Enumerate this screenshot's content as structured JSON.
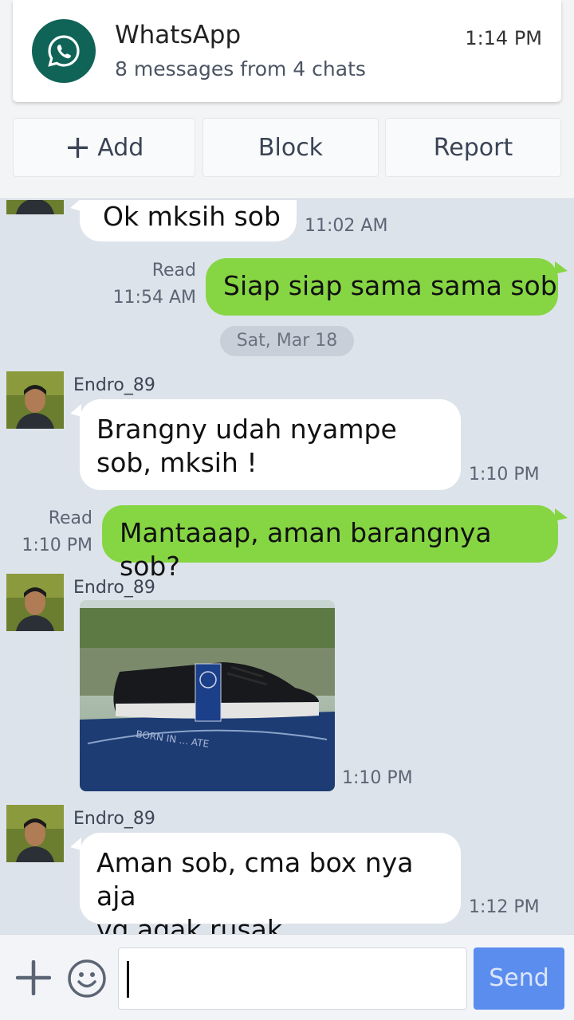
{
  "notification": {
    "app_name": "WhatsApp",
    "summary": "8 messages from 4 chats",
    "time": "1:14 PM",
    "icon": "whatsapp-icon"
  },
  "actions": {
    "add_label": "Add",
    "block_label": "Block",
    "report_label": "Report"
  },
  "chat": {
    "messages": [
      {
        "direction": "in",
        "text": "Ok mksih sob",
        "time": "11:02 AM"
      },
      {
        "direction": "out",
        "read": "Read",
        "text": "Siap siap sama sama sob",
        "time": "11:54 AM"
      },
      {
        "type": "date",
        "text": "Sat, Mar 18"
      },
      {
        "direction": "in",
        "sender": "Endro_89",
        "text_lines": [
          "Brangny udah nyampe",
          "sob, mksih !"
        ],
        "time": "1:10 PM"
      },
      {
        "direction": "out",
        "read": "Read",
        "text": "Mantaaap, aman barangnya sob?",
        "time": "1:10 PM"
      },
      {
        "direction": "in",
        "sender": "Endro_89",
        "type": "image",
        "image": "photo of black sneaker on a blue shoe box",
        "time": "1:10 PM"
      },
      {
        "direction": "in",
        "sender": "Endro_89",
        "text_lines": [
          "Aman sob, cma box nya aja",
          "yg agak rusak."
        ],
        "time": "1:12 PM"
      }
    ]
  },
  "input": {
    "value": "",
    "send_label": "Send"
  },
  "colors": {
    "whatsapp_green": "#0f6457",
    "outgoing_bubble": "#86d644",
    "chat_background": "#dde3ea",
    "send_button": "#5b8def"
  }
}
